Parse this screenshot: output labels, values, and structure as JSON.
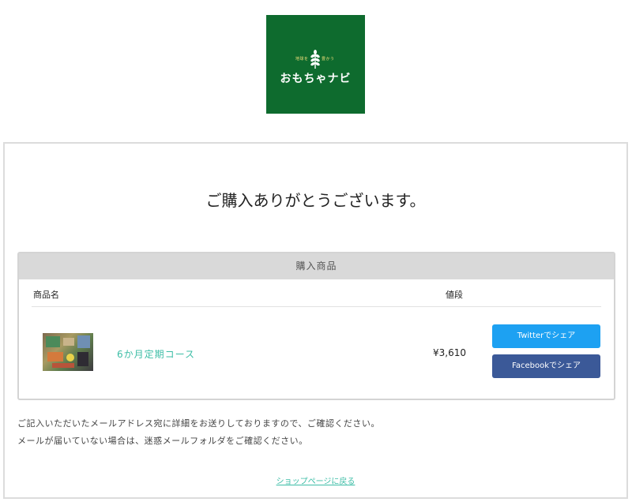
{
  "logo": {
    "name": "おもちゃナビ",
    "tag_left": "地球を",
    "tag_right": "豊かう",
    "colors": {
      "background": "#0e6b2e",
      "tag": "#f3e07a"
    }
  },
  "main": {
    "heading": "ご購入ありがとうございます。",
    "table": {
      "title": "購入商品",
      "columns": {
        "name": "商品名",
        "price": "値段"
      },
      "items": [
        {
          "name": "6か月定期コース",
          "price": "¥3,610"
        }
      ]
    },
    "share": {
      "twitter_label": "Twitterでシェア",
      "facebook_label": "Facebookでシェア",
      "colors": {
        "twitter": "#1da1f2",
        "facebook": "#3b5998"
      }
    },
    "notes": [
      "ご記入いただいたメールアドレス宛に詳細をお送りしておりますので、ご確認ください。",
      "メールが届いていない場合は、迷惑メールフォルダをご確認ください。"
    ],
    "back_link": "ショップページに戻る"
  },
  "accent_color": "#3cbda6"
}
